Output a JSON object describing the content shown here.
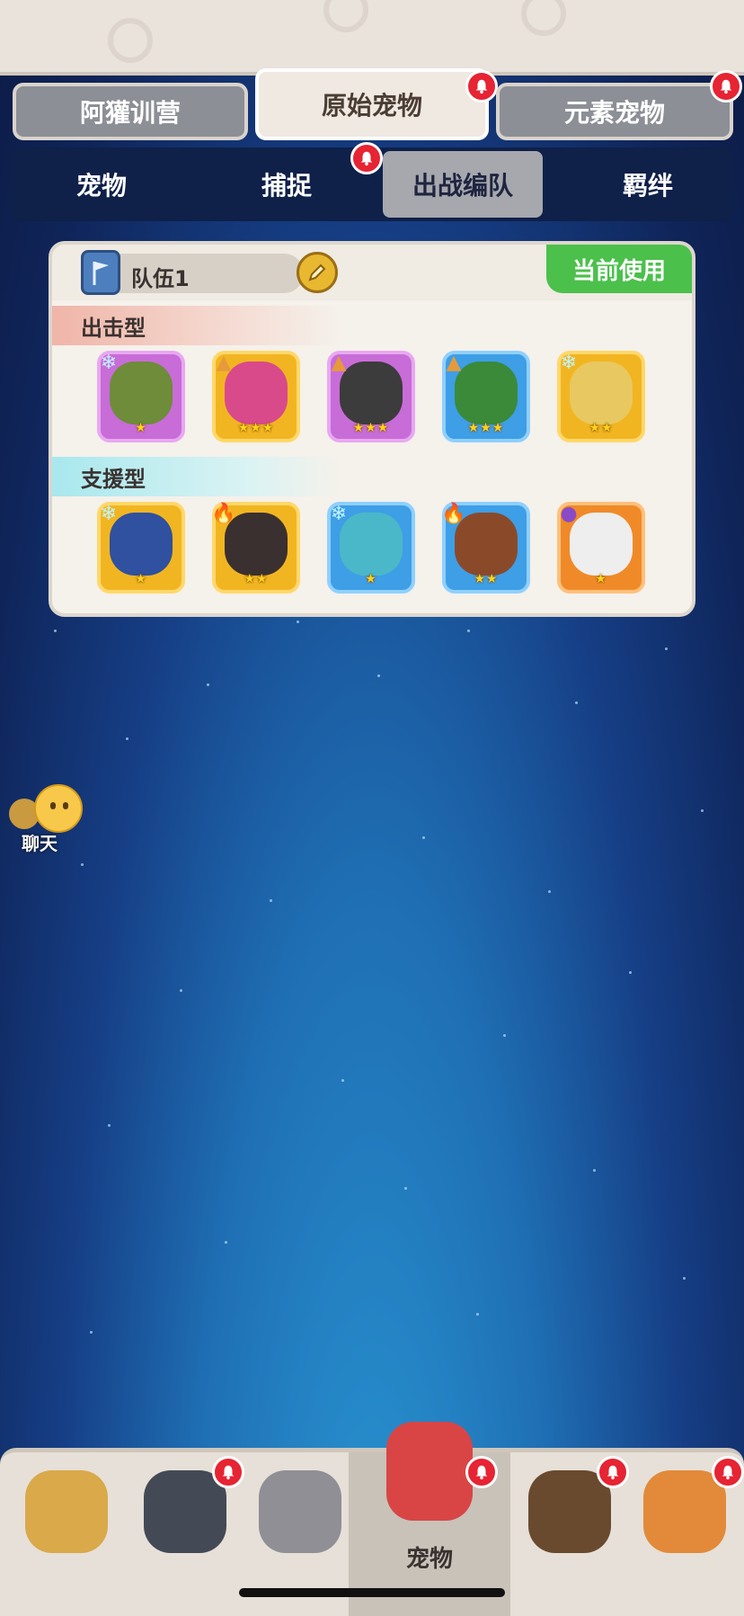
{
  "top_tabs": [
    {
      "label": "阿獾训营",
      "active": false,
      "badge": false
    },
    {
      "label": "原始宠物",
      "active": true,
      "badge": true
    },
    {
      "label": "元素宠物",
      "active": false,
      "badge": true
    }
  ],
  "sub_tabs": [
    {
      "label": "宠物",
      "active": false,
      "badge": false
    },
    {
      "label": "捕捉",
      "active": false,
      "badge": true
    },
    {
      "label": "出战编队",
      "active": true,
      "badge": false
    },
    {
      "label": "羁绊",
      "active": false,
      "badge": false
    }
  ],
  "team": {
    "name": "队伍1",
    "current_label": "当前使用",
    "attack_label": "出击型",
    "support_label": "支援型",
    "attack_pets": [
      {
        "element": "ice-icon",
        "frame": "purple",
        "stars": 1,
        "color": "#6e8c3a"
      },
      {
        "element": "earth-icon",
        "frame": "gold",
        "stars": 3,
        "color": "#d94a8a"
      },
      {
        "element": "earth-icon",
        "frame": "purple",
        "stars": 3,
        "color": "#3c3c3c"
      },
      {
        "element": "earth-icon",
        "frame": "blue",
        "stars": 3,
        "color": "#3a8a3a"
      },
      {
        "element": "ice-icon",
        "frame": "gold",
        "stars": 2,
        "color": "#e8c860"
      }
    ],
    "support_pets": [
      {
        "element": "ice-icon",
        "frame": "gold",
        "stars": 1,
        "color": "#3050a0"
      },
      {
        "element": "fire-icon",
        "frame": "gold",
        "stars": 2,
        "color": "#3a3030"
      },
      {
        "element": "ice-icon",
        "frame": "blue",
        "stars": 1,
        "color": "#4ab8c8"
      },
      {
        "element": "fire-icon",
        "frame": "blue",
        "stars": 2,
        "color": "#8a4a2a"
      },
      {
        "element": "poison-icon",
        "frame": "orange",
        "stars": 1,
        "color": "#eeeeee"
      }
    ]
  },
  "chat": {
    "label": "聊天"
  },
  "bottom_nav": [
    {
      "name": "nav-caveman",
      "label": "",
      "active": false,
      "badge": false,
      "color": "#d9a94a"
    },
    {
      "name": "nav-hero",
      "label": "",
      "active": false,
      "badge": true,
      "color": "#444a55"
    },
    {
      "name": "nav-weapon",
      "label": "",
      "active": false,
      "badge": false,
      "color": "#8f8f95"
    },
    {
      "name": "nav-pets",
      "label": "宠物",
      "active": true,
      "badge": true,
      "color": "#d94545"
    },
    {
      "name": "nav-bear",
      "label": "",
      "active": false,
      "badge": true,
      "color": "#6a4a2e"
    },
    {
      "name": "nav-totem",
      "label": "",
      "active": false,
      "badge": true,
      "color": "#e28a3a"
    }
  ]
}
